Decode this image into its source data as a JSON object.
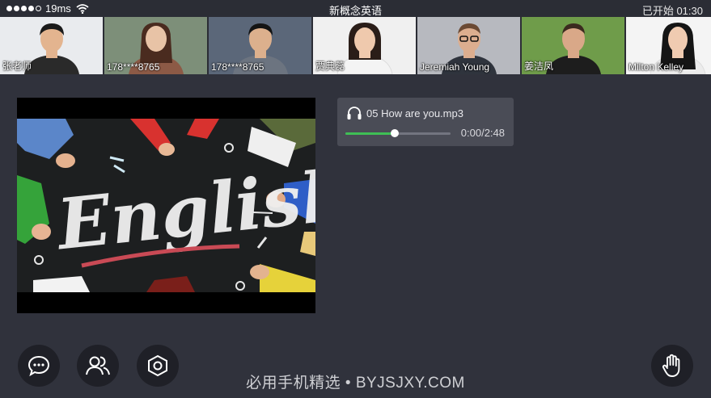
{
  "status_bar": {
    "signal": "●●●●○",
    "latency": "19ms",
    "title": "新概念英语",
    "class_status": "已开始 01:30"
  },
  "participants": [
    {
      "name": "张老师",
      "bg": "#e9ebee",
      "shirt": "#2a2a2a",
      "skin": "#e3b48f"
    },
    {
      "name": "178****8765",
      "bg": "#7d8f79",
      "shirt": "#8c5a46",
      "skin": "#e8c3a6"
    },
    {
      "name": "178****8765",
      "bg": "#5b6779",
      "shirt": "#6c7480",
      "skin": "#dcb08d"
    },
    {
      "name": "贾典蕊",
      "bg": "#f0f0f0",
      "shirt": "#f4f4f4",
      "skin": "#efc9ad"
    },
    {
      "name": "Jeremiah Young",
      "bg": "#b7b9bf",
      "shirt": "#2f343d",
      "skin": "#dcae8f"
    },
    {
      "name": "姜洁凤",
      "bg": "#6f9c4a",
      "shirt": "#1d1d1d",
      "skin": "#d9a888"
    },
    {
      "name": "Milton Kelley",
      "bg": "#f4f4f4",
      "shirt": "#ececec",
      "skin": "#f0cbb1"
    }
  ],
  "video": {
    "board_text": "English"
  },
  "audio": {
    "title": "05 How are you.mp3",
    "time": "0:00/2:48",
    "progress_fraction": 0.47,
    "accent": "#3fbf55"
  },
  "controls": [
    {
      "name": "chat",
      "icon": "chat-bubble-icon"
    },
    {
      "name": "members",
      "icon": "people-icon"
    },
    {
      "name": "settings",
      "icon": "hexagon-icon"
    },
    {
      "name": "raise-hand",
      "icon": "hand-icon"
    }
  ],
  "watermark": "必用手机精选 • BYJSJXY.COM"
}
